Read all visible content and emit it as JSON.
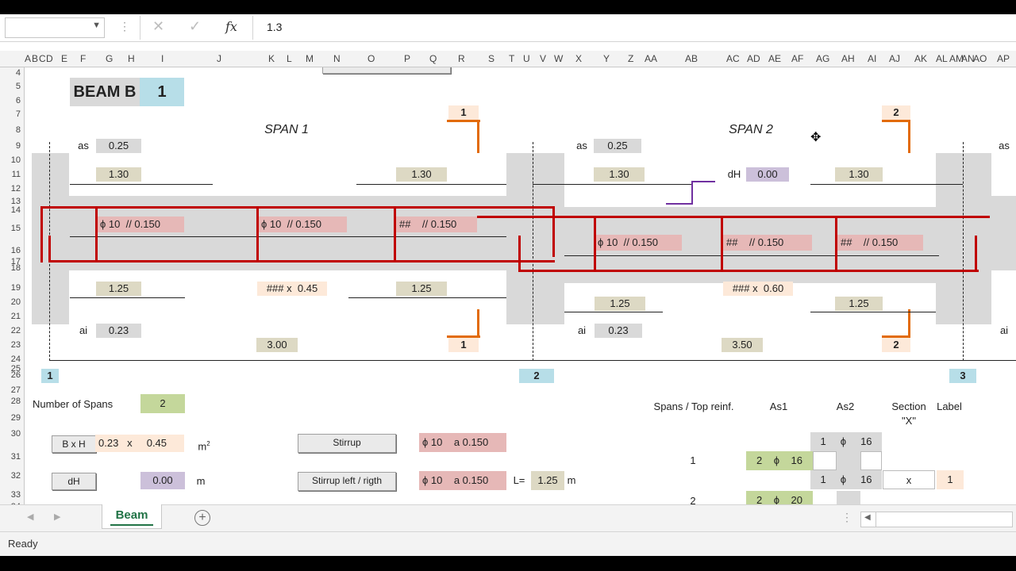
{
  "formula_bar": {
    "name_box": "",
    "cancel_icon": "✕",
    "enter_icon": "✓",
    "fx_label": "fx",
    "value": "1.3"
  },
  "columns": [
    "A",
    "B",
    "C",
    "D",
    "E",
    "F",
    "G",
    "H",
    "I",
    "J",
    "K",
    "L",
    "M",
    "N",
    "O",
    "P",
    "Q",
    "R",
    "S",
    "T",
    "U",
    "V",
    "W",
    "X",
    "Y",
    "Z",
    "AA",
    "AB",
    "AC",
    "AD",
    "AE",
    "AF",
    "AG",
    "AH",
    "AI",
    "AJ",
    "AK",
    "AL",
    "AM",
    "AN",
    "AO",
    "AP"
  ],
  "rows": [
    "4",
    "5",
    "6",
    "7",
    "8",
    "9",
    "10",
    "11",
    "12",
    "13",
    "14",
    "15",
    "16",
    "17",
    "18",
    "19",
    "20",
    "21",
    "22",
    "23",
    "24",
    "25",
    "26",
    "27",
    "28",
    "29",
    "30",
    "31",
    "32",
    "33",
    "34"
  ],
  "beam": {
    "label": "BEAM B",
    "number": "1"
  },
  "spans": [
    {
      "title": "SPAN 1"
    },
    {
      "title": "SPAN 2"
    }
  ],
  "sections": [
    "1",
    "2"
  ],
  "span1": {
    "as_label": "as",
    "as_value": "0.25",
    "left_top_len": "1.30",
    "right_top_len": "1.30",
    "stirrups": [
      {
        "bar": "ϕ 10",
        "spacing": "// 0.150"
      },
      {
        "bar": "ϕ 10",
        "spacing": "// 0.150"
      },
      {
        "bar": "##",
        "spacing": "// 0.150"
      }
    ],
    "left_bot_len": "1.25",
    "right_bot_len": "1.25",
    "bottom_bars": "###",
    "mult": "x",
    "depth": "0.45",
    "ai_label": "ai",
    "ai_value": "0.23",
    "length": "3.00"
  },
  "span2": {
    "as_label": "as",
    "as_value": "0.25",
    "left_top_len": "1.30",
    "right_top_len": "1.30",
    "dh_label": "dH",
    "dh_value": "0.00",
    "stirrups": [
      {
        "bar": "ϕ 10",
        "spacing": "// 0.150"
      },
      {
        "bar": "##",
        "spacing": "// 0.150"
      },
      {
        "bar": "##",
        "spacing": "// 0.150"
      }
    ],
    "left_bot_len": "1.25",
    "right_bot_len": "1.25",
    "bottom_bars": "###",
    "mult": "x",
    "depth": "0.60",
    "ai_label": "ai",
    "ai_value": "0.23",
    "length": "3.50"
  },
  "span3": {
    "as_label": "as",
    "ai_label": "ai"
  },
  "supports": [
    "1",
    "2",
    "3"
  ],
  "controls": {
    "num_spans_label": "Number of Spans",
    "num_spans_value": "2",
    "bxh_button": "B x H",
    "b_value": "0.23",
    "x": "x",
    "h_value": "0.45",
    "m2_unit": "m",
    "m2_exp": "2",
    "dh_button": "dH",
    "dh_value": "0.00",
    "m_unit": "m",
    "stirrup_button": "Stirrup",
    "stirrup_bar": "ϕ 10",
    "stirrup_spacing": "a 0.150",
    "stirrup_lr_button": "Stirrup left / rigth",
    "stirrup_lr_bar": "ϕ 10",
    "stirrup_lr_spacing": "a 0.150",
    "l_label": "L=",
    "l_value": "1.25",
    "l_unit": "m"
  },
  "reinf_table": {
    "headers": [
      "Spans / Top reinf.",
      "As1",
      "As2",
      "Section",
      "Label"
    ],
    "section_sub": "\"X\"",
    "row_a": {
      "n": "1",
      "phi": "ϕ",
      "d": "16"
    },
    "row1": {
      "span": "1",
      "n": "2",
      "phi": "ϕ",
      "d": "16"
    },
    "row_b": {
      "n": "1",
      "phi": "ϕ",
      "d": "16",
      "section": "x",
      "label": "1"
    },
    "row2": {
      "span": "2",
      "n": "2",
      "phi": "ϕ",
      "d": "20"
    }
  },
  "tabs": [
    {
      "label": "Beam",
      "active": true
    }
  ],
  "status": "Ready"
}
